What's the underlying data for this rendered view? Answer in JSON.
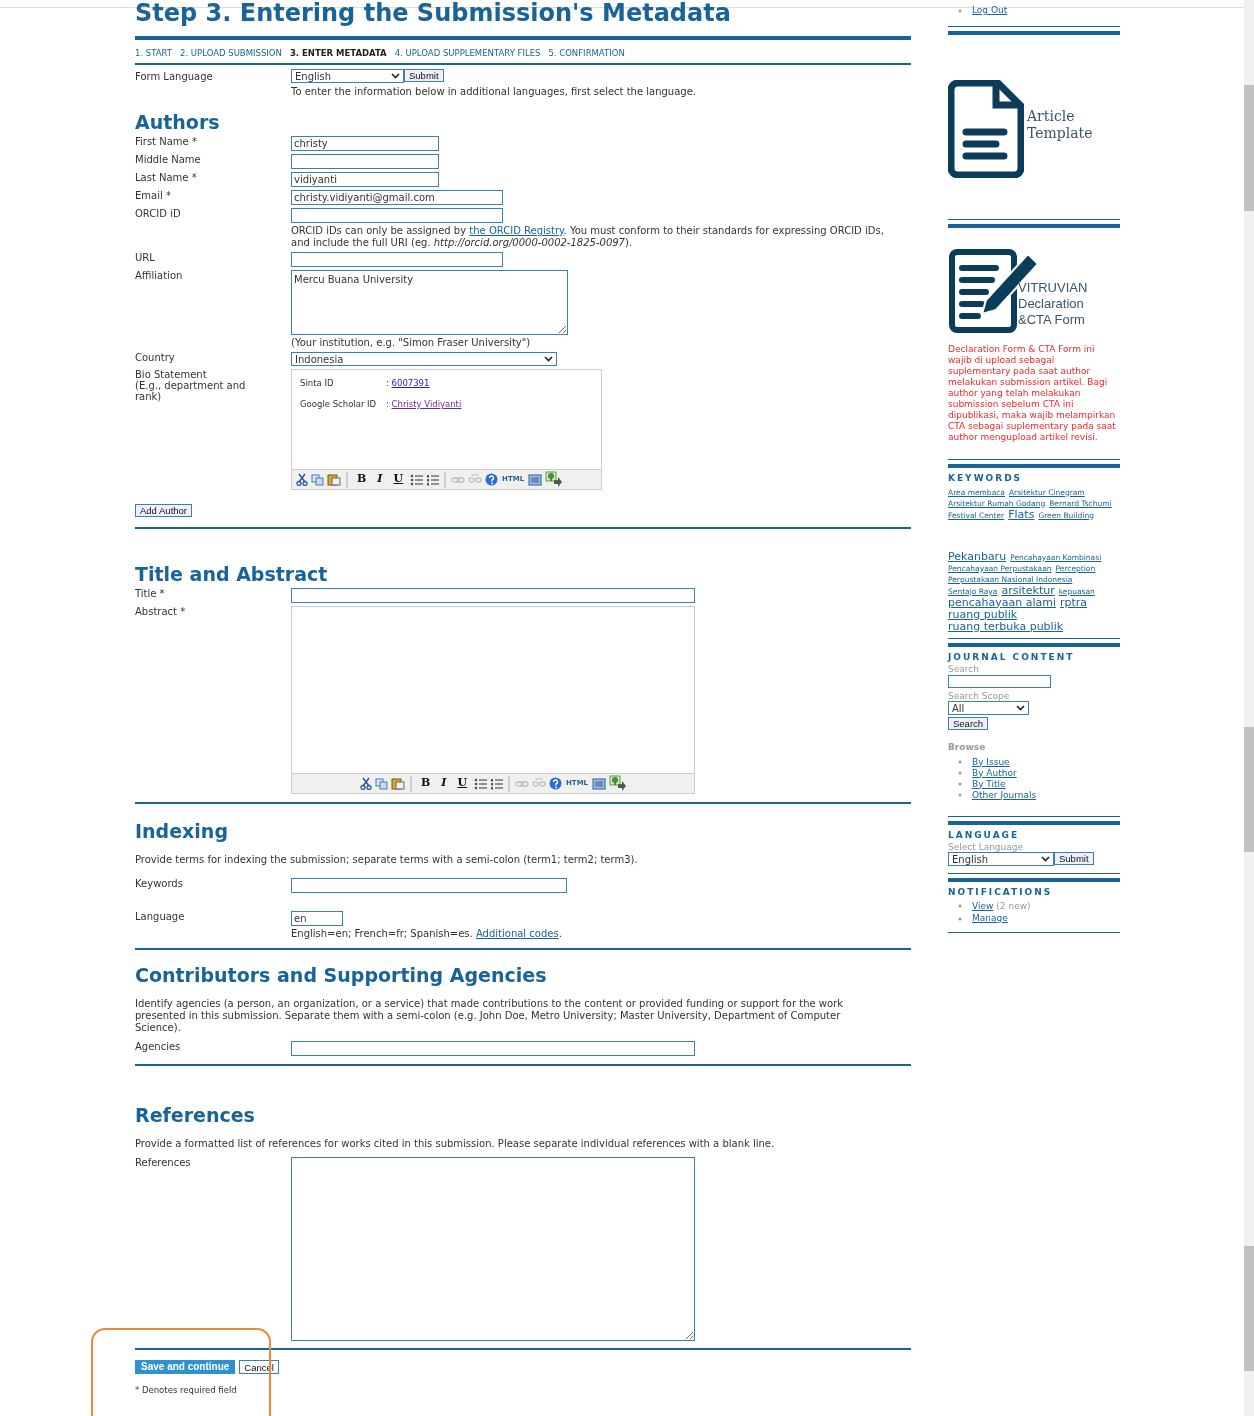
{
  "page_title": "Step 3. Entering the Submission's Metadata",
  "steps": [
    {
      "label": "1. START",
      "selected": false
    },
    {
      "label": "2. UPLOAD SUBMISSION",
      "selected": false
    },
    {
      "label": "3. ENTER METADATA",
      "selected": true
    },
    {
      "label": "4. UPLOAD SUPPLEMENTARY FILES",
      "selected": false
    },
    {
      "label": "5. CONFIRMATION",
      "selected": false
    }
  ],
  "form_language": {
    "label": "Form Language",
    "value": "English",
    "button": "Submit",
    "hint": "To enter the information below in additional languages, first select the language."
  },
  "sections": [
    {
      "heading": "Authors",
      "fields": [
        {
          "kind": "text",
          "label": "First Name *",
          "value": "christy"
        },
        {
          "kind": "text",
          "label": "Middle Name"
        },
        {
          "kind": "text",
          "label": "Last Name *",
          "value": "vidiyanti"
        },
        {
          "kind": "text",
          "label": "Email *",
          "value": "christy.vidiyanti@gmail.com"
        },
        {
          "kind": "text",
          "label": "ORCID iD",
          "note": {
            "before": "ORCID iDs can only be assigned by ",
            "link": "the ORCID Registry",
            "after": ". You must conform to their standards for expressing ORCID iDs, and include the full URI (eg. *http://orcid.org/0000-0002-1825-0097*)."
          }
        },
        {
          "kind": "text",
          "label": "URL"
        },
        {
          "kind": "textarea",
          "label": "Affiliation",
          "value": "Mercu Buana University",
          "note": {
            "before": "(Your institution, e.g. \"Simon Fraser University\")"
          }
        },
        {
          "kind": "select",
          "label": "Country",
          "value": "Indonesia"
        },
        {
          "kind": "editor",
          "label": "Bio Statement",
          "sublabel": "(E.g., department and rank)",
          "lines": [
            {
              "label": "Sinta ID",
              "separator": ": ",
              "link": "6007391",
              "visited": false
            },
            {
              "label": "Google Scholar ID",
              "separator": ": ",
              "link": "Christy Vidiyanti",
              "visited": true
            }
          ],
          "toolbar": [
            {
              "kind": "cut",
              "disabled": false
            },
            {
              "kind": "copy",
              "disabled": false
            },
            {
              "kind": "paste",
              "disabled": false
            },
            {
              "kind": "separator"
            },
            {
              "kind": "bold",
              "text": "B",
              "disabled": false
            },
            {
              "kind": "italic",
              "text": "I",
              "disabled": false
            },
            {
              "kind": "underline",
              "text": "U",
              "disabled": false
            },
            {
              "kind": "bullets",
              "disabled": false
            },
            {
              "kind": "numbers",
              "disabled": false
            },
            {
              "kind": "separator"
            },
            {
              "kind": "link",
              "disabled": true
            },
            {
              "kind": "unlink",
              "disabled": true
            },
            {
              "kind": "help",
              "disabled": false
            },
            {
              "kind": "html",
              "text": "HTML",
              "disabled": false
            },
            {
              "kind": "fullscreen",
              "disabled": false
            },
            {
              "kind": "image",
              "disabled": false
            }
          ]
        }
      ],
      "button": "Add Author"
    },
    {
      "heading": "Title and Abstract",
      "fields": [
        {
          "kind": "text",
          "label": "Title *"
        },
        {
          "kind": "editor",
          "label": "Abstract *",
          "toolbar": [
            {
              "kind": "cut",
              "disabled": false
            },
            {
              "kind": "copy",
              "disabled": false
            },
            {
              "kind": "paste",
              "disabled": false
            },
            {
              "kind": "separator"
            },
            {
              "kind": "bold",
              "text": "B",
              "disabled": false
            },
            {
              "kind": "italic",
              "text": "I",
              "disabled": false
            },
            {
              "kind": "underline",
              "text": "U",
              "disabled": false
            },
            {
              "kind": "bullets",
              "disabled": false
            },
            {
              "kind": "numbers",
              "disabled": false
            },
            {
              "kind": "separator"
            },
            {
              "kind": "link",
              "disabled": true
            },
            {
              "kind": "unlink",
              "disabled": true
            },
            {
              "kind": "help",
              "disabled": false
            },
            {
              "kind": "html",
              "text": "HTML",
              "disabled": false
            },
            {
              "kind": "fullscreen",
              "disabled": false
            },
            {
              "kind": "image",
              "disabled": false
            }
          ]
        }
      ]
    },
    {
      "heading": "Indexing",
      "description": "Provide terms for indexing the submission; separate terms with a semi-colon (term1; term2; term3).",
      "fields": [
        {
          "kind": "text",
          "label": "Keywords"
        },
        {
          "kind": "text",
          "label": "Language",
          "value": "en",
          "note": {
            "before": "English=en; French=fr; Spanish=es. ",
            "link": "Additional codes",
            "after": "."
          }
        }
      ]
    },
    {
      "heading": "Contributors and Supporting Agencies",
      "description": "Identify agencies (a person, an organization, or a service) that made contributions to the content or provided funding or support for the work presented in this submission. Separate them with a semi-colon (e.g. John Doe, Metro University; Master University, Department of Computer Science).",
      "fields": [
        {
          "kind": "text",
          "label": "Agencies"
        }
      ]
    },
    {
      "heading": "References",
      "description": "Provide a formatted list of references for works cited in this submission. Please separate individual references with a blank line.",
      "fields": [
        {
          "kind": "textarea",
          "label": "References"
        }
      ]
    }
  ],
  "actions": {
    "save": "Save and continue",
    "cancel": "Cancel",
    "footnote": "* Denotes required field"
  },
  "sidebar": {
    "user_links": [
      "Log Out"
    ],
    "banners": [
      {
        "kind": "document",
        "lines": [
          "Article",
          "Template"
        ]
      },
      {
        "kind": "pen",
        "lines": [
          "VITRUVIAN",
          "Declaration",
          "&CTA Form"
        ],
        "caption": "Declaration Form & CTA Form ini wajib di upload sebagai suplementary pada saat author melakukan submission artikel. Bagi author yang telah melakukan submission sebelum CTA ini dipublikasi, maka wajib melampirkan CTA sebagai suplementary pada saat author mengupload artikel revisi."
      }
    ],
    "keywords": {
      "heading": "KEYWORDS",
      "groups": [
        [
          {
            "text": "Area membaca",
            "kind": "small"
          },
          {
            "text": "Arsitektur Cinegram",
            "kind": "small"
          },
          {
            "text": "Arsitektur Rumah Godang",
            "kind": "small"
          },
          {
            "text": "Bernard Tschumi",
            "kind": "small"
          },
          {
            "text": "Festival Center",
            "kind": "small"
          },
          {
            "text": "Flats",
            "kind": "large"
          },
          {
            "text": "Green Building",
            "kind": "small"
          }
        ],
        [
          {
            "text": "Pekanbaru",
            "kind": "large"
          },
          {
            "text": "Pencahayaan Kombinasi",
            "kind": "small"
          },
          {
            "text": "Pencahayaan Perpustakaan",
            "kind": "small"
          },
          {
            "text": "Perception",
            "kind": "small"
          },
          {
            "text": "Perpustakaan Nasional Indonesia",
            "kind": "small"
          },
          {
            "text": "Sentajo Raya",
            "kind": "small"
          },
          {
            "text": "arsitektur",
            "kind": "large"
          },
          {
            "text": "kepuasan",
            "kind": "small"
          },
          {
            "text": "pencahayaan alami",
            "kind": "large"
          },
          {
            "text": "rptra",
            "kind": "large"
          },
          {
            "text": "ruang publik",
            "kind": "large"
          },
          {
            "text": "ruang terbuka publik",
            "kind": "large"
          }
        ]
      ]
    },
    "journal_content": {
      "heading": "JOURNAL CONTENT",
      "search_label": "Search",
      "scope_label": "Search Scope",
      "scope_value": "All",
      "search_button": "Search",
      "browse_label": "Browse",
      "browse_links": [
        "By Issue",
        "By Author",
        "By Title",
        "Other Journals"
      ]
    },
    "language": {
      "heading": "LANGUAGE",
      "label": "Select Language",
      "value": "English",
      "button": "Submit"
    },
    "notifications": {
      "heading": "NOTIFICATIONS",
      "items": [
        {
          "link": "View",
          "note": "(2 new)"
        },
        {
          "link": "Manage"
        }
      ]
    }
  }
}
